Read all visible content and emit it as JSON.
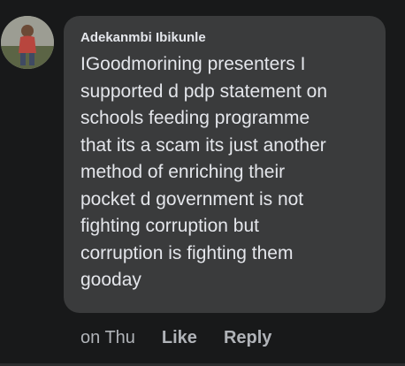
{
  "comment": {
    "author": "Adekanmbi Ibikunle",
    "text": "IGoodmorining presenters  I\nsupported d pdp statement on\nschools feeding programme\nthat its a scam its just another\nmethod of enriching their\npocket d government is not\nfighting corruption but\ncorruption is fighting them\ngooday",
    "avatar_icon": "profile-photo"
  },
  "actions": {
    "timestamp": "on Thu",
    "like_label": "Like",
    "reply_label": "Reply"
  },
  "colors": {
    "background": "#18191a",
    "bubble": "#3a3b3c",
    "primary_text": "#e4e6eb",
    "secondary_text": "#b0b3b8"
  }
}
